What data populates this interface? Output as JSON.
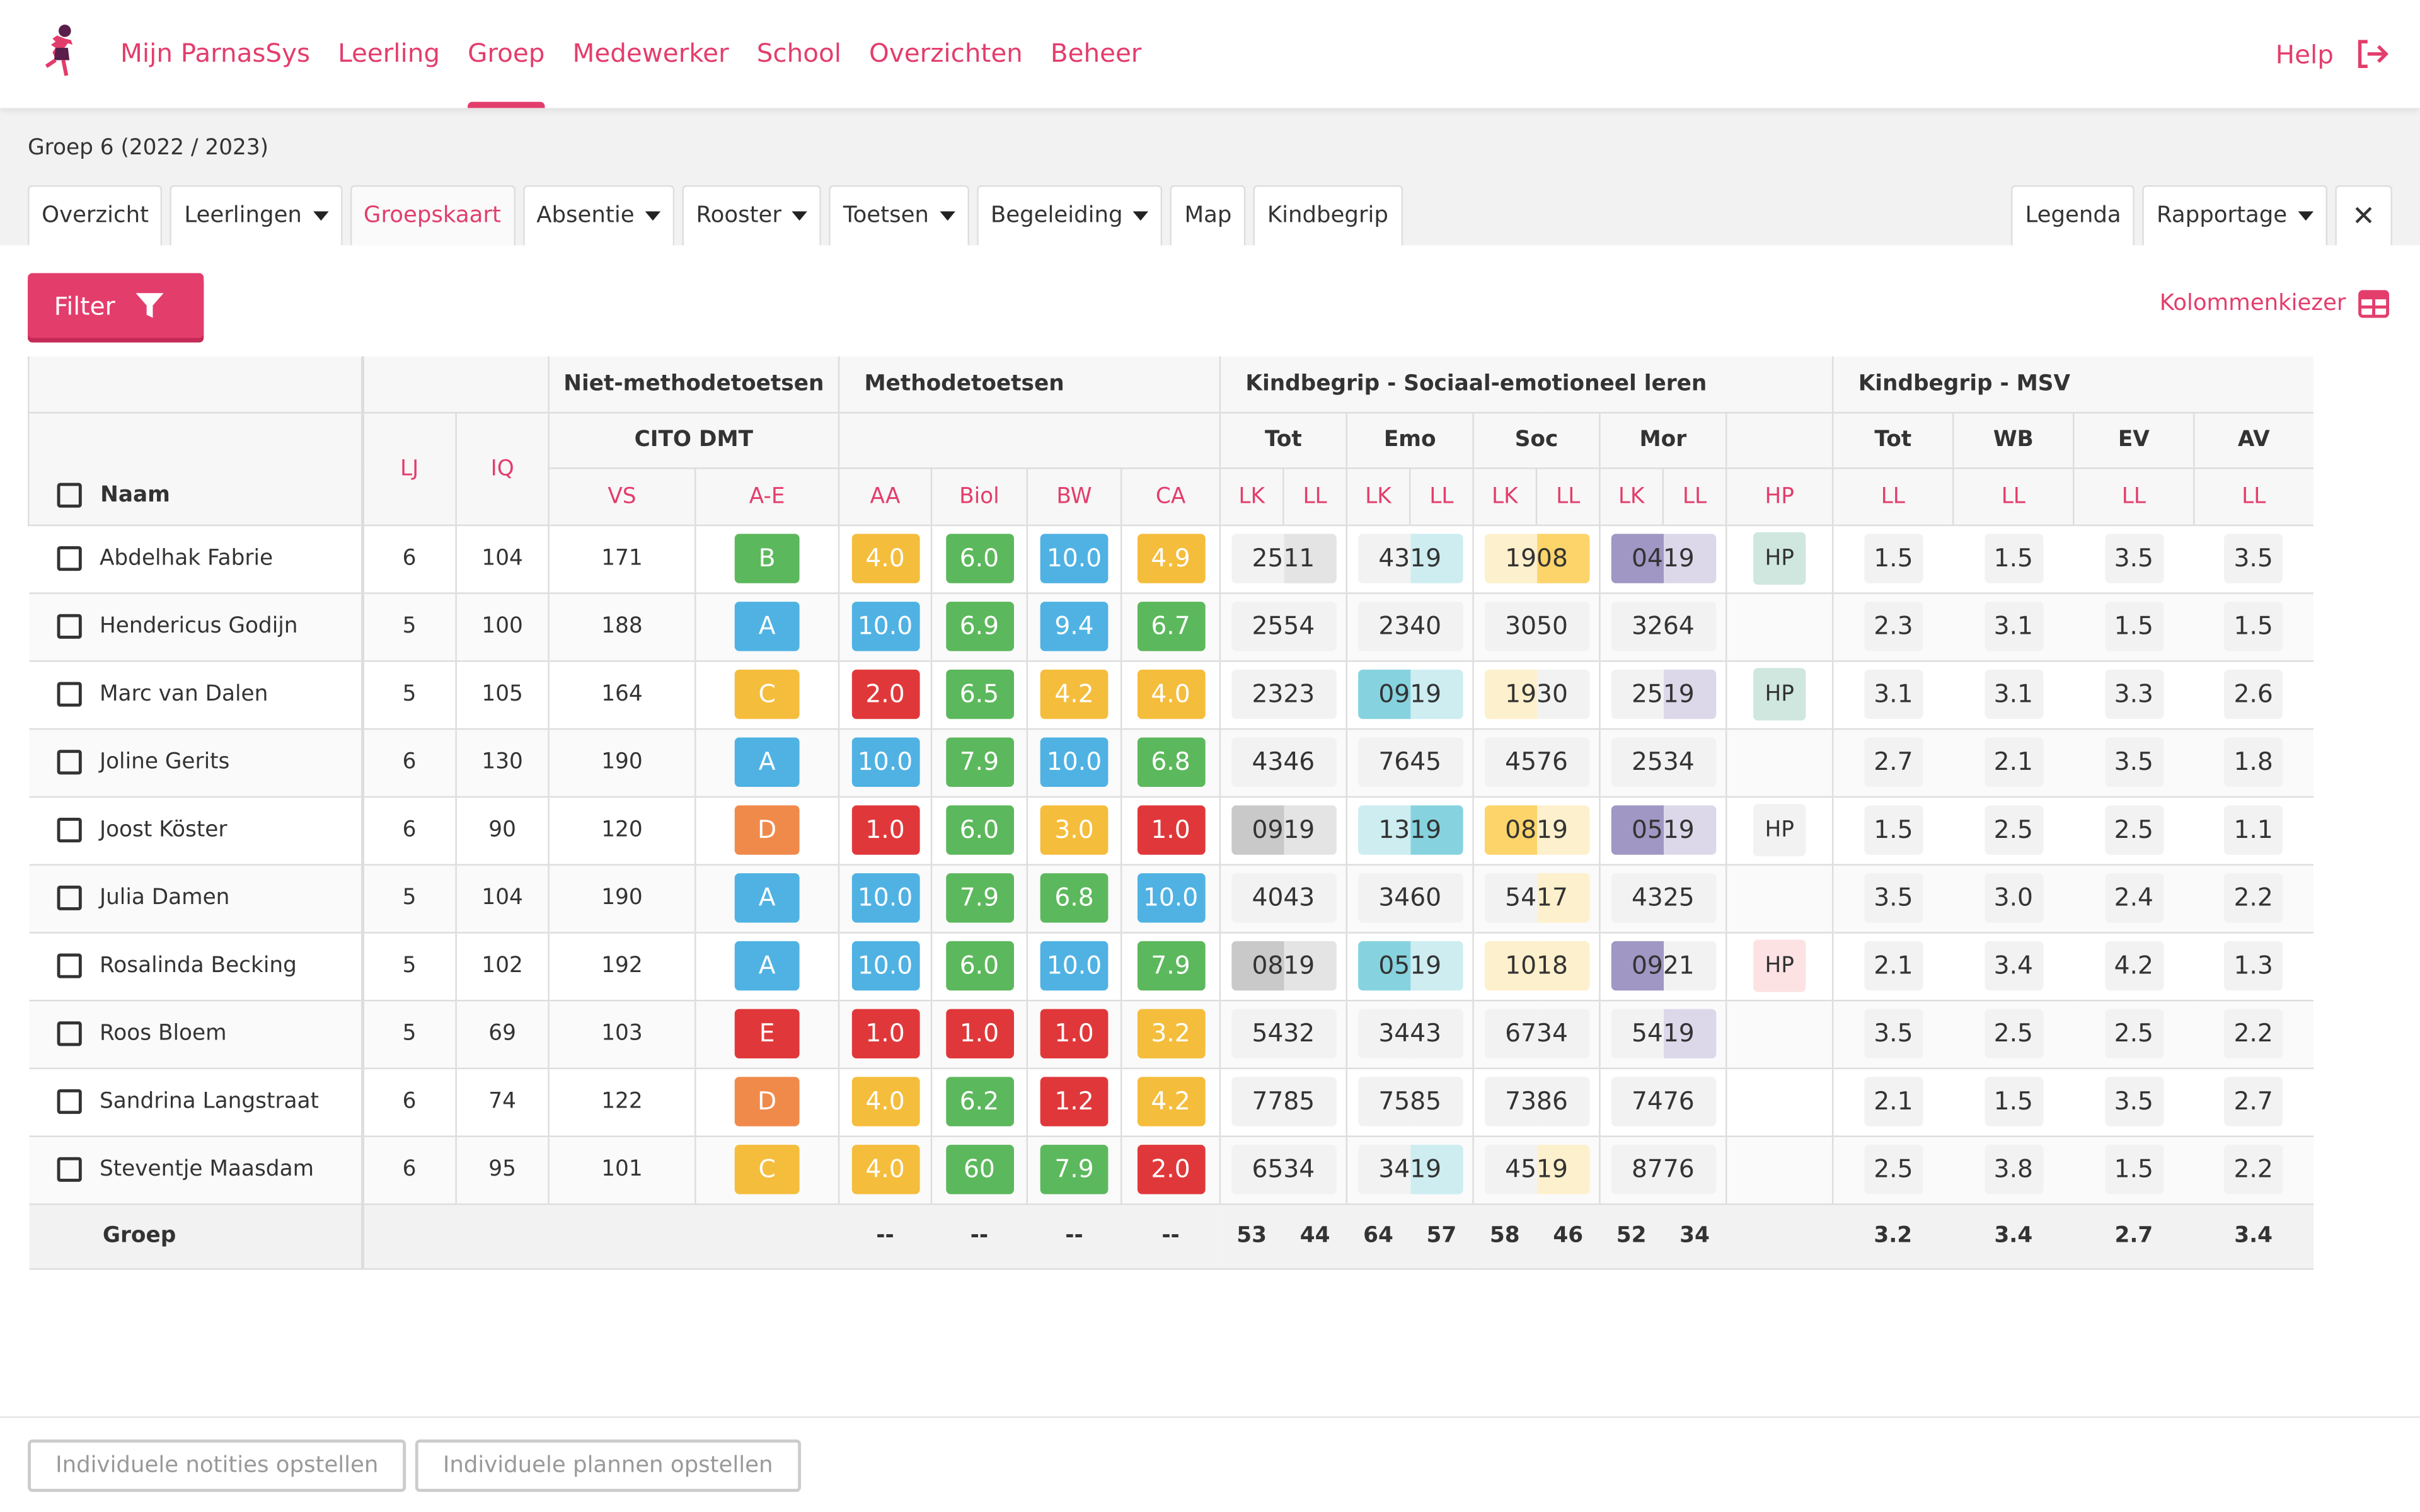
{
  "nav": {
    "items": [
      "Mijn ParnasSys",
      "Leerling",
      "Groep",
      "Medewerker",
      "School",
      "Overzichten",
      "Beheer"
    ],
    "active": "Groep",
    "help": "Help",
    "logout_icon": "logout-icon",
    "brand_color": "#e33d6c"
  },
  "page": {
    "title": "Groep 6 (2022 / 2023)"
  },
  "tabs": [
    {
      "label": "Overzicht",
      "dropdown": false
    },
    {
      "label": "Leerlingen",
      "dropdown": true
    },
    {
      "label": "Groepskaart",
      "dropdown": false,
      "active": true
    },
    {
      "label": "Absentie",
      "dropdown": true
    },
    {
      "label": "Rooster",
      "dropdown": true
    },
    {
      "label": "Toetsen",
      "dropdown": true
    },
    {
      "label": "Begeleiding",
      "dropdown": true
    },
    {
      "label": "Map",
      "dropdown": false
    },
    {
      "label": "Kindbegrip",
      "dropdown": false
    }
  ],
  "tabs_right": {
    "legenda": "Legenda",
    "rapportage": "Rapportage",
    "close": "✕"
  },
  "toolbar": {
    "filter": "Filter",
    "kolommenkiezer": "Kolommenkiezer"
  },
  "headers": {
    "naam": "Naam",
    "lj": "LJ",
    "iq": "IQ",
    "niet_methode": "Niet-methodetoetsen",
    "cito": "CITO  DMT",
    "vs": "VS",
    "ae": "A-E",
    "methode": "Methodetoetsen",
    "aa": "AA",
    "biol": "Biol",
    "bw": "BW",
    "ca": "CA",
    "kb_sel": "Kindbegrip - Sociaal-emotioneel leren",
    "kb_groups": [
      "Tot",
      "Emo",
      "Soc",
      "Mor"
    ],
    "lk": "LK",
    "ll": "LL",
    "hp": "HP",
    "kb_msv": "Kindbegrip - MSV",
    "msv_groups": [
      "Tot",
      "WB",
      "EV",
      "AV"
    ]
  },
  "colors": {
    "Y": "#f5bd3c",
    "G": "#5cb85c",
    "B": "#4fb2e3",
    "R": "#e0383a",
    "O": "#f08a4b",
    "d": "#f2f2f2",
    "g1": "#e4e4e4",
    "g2": "#c9c9c9",
    "cl": "#cdedf1",
    "c": "#86d3df",
    "yl": "#fdf0cc",
    "y": "#fdd46a",
    "p": "#a097c4",
    "pl": "#dcd8ea",
    "mint": "#cfe7df",
    "pink": "#fde2e4"
  },
  "rows": [
    {
      "naam": "Abdelhak Fabrie",
      "lj": "6",
      "iq": "104",
      "vs": "171",
      "ae": [
        "B",
        "G"
      ],
      "met": [
        [
          "4.0",
          "Y"
        ],
        [
          "6.0",
          "G"
        ],
        [
          "10.0",
          "B"
        ],
        [
          "4.9",
          "Y"
        ]
      ],
      "kb": [
        [
          "25",
          "d"
        ],
        [
          "11",
          "g1"
        ],
        [
          "43",
          "d"
        ],
        [
          "19",
          "cl"
        ],
        [
          "19",
          "yl"
        ],
        [
          "08",
          "y"
        ],
        [
          "04",
          "p"
        ],
        [
          "19",
          "pl"
        ]
      ],
      "hp": [
        "HP",
        "mint"
      ],
      "msv": [
        "1.5",
        "1.5",
        "3.5",
        "3.5"
      ]
    },
    {
      "naam": "Hendericus Godijn",
      "lj": "5",
      "iq": "100",
      "vs": "188",
      "ae": [
        "A",
        "B"
      ],
      "met": [
        [
          "10.0",
          "B"
        ],
        [
          "6.9",
          "G"
        ],
        [
          "9.4",
          "B"
        ],
        [
          "6.7",
          "G"
        ]
      ],
      "kb": [
        [
          "25",
          "d"
        ],
        [
          "54",
          "d"
        ],
        [
          "23",
          "d"
        ],
        [
          "40",
          "d"
        ],
        [
          "30",
          "d"
        ],
        [
          "50",
          "d"
        ],
        [
          "32",
          "d"
        ],
        [
          "64",
          "d"
        ]
      ],
      "hp": null,
      "msv": [
        "2.3",
        "3.1",
        "1.5",
        "1.5"
      ]
    },
    {
      "naam": "Marc van Dalen",
      "lj": "5",
      "iq": "105",
      "vs": "164",
      "ae": [
        "C",
        "Y"
      ],
      "met": [
        [
          "2.0",
          "R"
        ],
        [
          "6.5",
          "G"
        ],
        [
          "4.2",
          "Y"
        ],
        [
          "4.0",
          "Y"
        ]
      ],
      "kb": [
        [
          "23",
          "d"
        ],
        [
          "23",
          "d"
        ],
        [
          "09",
          "c"
        ],
        [
          "19",
          "cl"
        ],
        [
          "19",
          "yl"
        ],
        [
          "30",
          "d"
        ],
        [
          "25",
          "d"
        ],
        [
          "19",
          "pl"
        ]
      ],
      "hp": [
        "HP",
        "mint"
      ],
      "msv": [
        "3.1",
        "3.1",
        "3.3",
        "2.6"
      ]
    },
    {
      "naam": "Joline Gerits",
      "lj": "6",
      "iq": "130",
      "vs": "190",
      "ae": [
        "A",
        "B"
      ],
      "met": [
        [
          "10.0",
          "B"
        ],
        [
          "7.9",
          "G"
        ],
        [
          "10.0",
          "B"
        ],
        [
          "6.8",
          "G"
        ]
      ],
      "kb": [
        [
          "43",
          "d"
        ],
        [
          "46",
          "d"
        ],
        [
          "76",
          "d"
        ],
        [
          "45",
          "d"
        ],
        [
          "45",
          "d"
        ],
        [
          "76",
          "d"
        ],
        [
          "25",
          "d"
        ],
        [
          "34",
          "d"
        ]
      ],
      "hp": null,
      "msv": [
        "2.7",
        "2.1",
        "3.5",
        "1.8"
      ]
    },
    {
      "naam": "Joost Köster",
      "lj": "6",
      "iq": "90",
      "vs": "120",
      "ae": [
        "D",
        "O"
      ],
      "met": [
        [
          "1.0",
          "R"
        ],
        [
          "6.0",
          "G"
        ],
        [
          "3.0",
          "Y"
        ],
        [
          "1.0",
          "R"
        ]
      ],
      "kb": [
        [
          "09",
          "g2"
        ],
        [
          "19",
          "g1"
        ],
        [
          "13",
          "cl"
        ],
        [
          "19",
          "c"
        ],
        [
          "08",
          "y"
        ],
        [
          "19",
          "yl"
        ],
        [
          "05",
          "p"
        ],
        [
          "19",
          "pl"
        ]
      ],
      "hp": [
        "HP",
        "d"
      ],
      "msv": [
        "1.5",
        "2.5",
        "2.5",
        "1.1"
      ]
    },
    {
      "naam": "Julia Damen",
      "lj": "5",
      "iq": "104",
      "vs": "190",
      "ae": [
        "A",
        "B"
      ],
      "met": [
        [
          "10.0",
          "B"
        ],
        [
          "7.9",
          "G"
        ],
        [
          "6.8",
          "G"
        ],
        [
          "10.0",
          "B"
        ]
      ],
      "kb": [
        [
          "40",
          "d"
        ],
        [
          "43",
          "d"
        ],
        [
          "34",
          "d"
        ],
        [
          "60",
          "d"
        ],
        [
          "54",
          "d"
        ],
        [
          "17",
          "yl"
        ],
        [
          "43",
          "d"
        ],
        [
          "25",
          "d"
        ]
      ],
      "hp": null,
      "msv": [
        "3.5",
        "3.0",
        "2.4",
        "2.2"
      ]
    },
    {
      "naam": "Rosalinda Becking",
      "lj": "5",
      "iq": "102",
      "vs": "192",
      "ae": [
        "A",
        "B"
      ],
      "met": [
        [
          "10.0",
          "B"
        ],
        [
          "6.0",
          "G"
        ],
        [
          "10.0",
          "B"
        ],
        [
          "7.9",
          "G"
        ]
      ],
      "kb": [
        [
          "08",
          "g2"
        ],
        [
          "19",
          "g1"
        ],
        [
          "05",
          "c"
        ],
        [
          "19",
          "cl"
        ],
        [
          "10",
          "yl"
        ],
        [
          "18",
          "yl"
        ],
        [
          "09",
          "p"
        ],
        [
          "21",
          "d"
        ]
      ],
      "hp": [
        "HP",
        "pink"
      ],
      "msv": [
        "2.1",
        "3.4",
        "4.2",
        "1.3"
      ]
    },
    {
      "naam": "Roos Bloem",
      "lj": "5",
      "iq": "69",
      "vs": "103",
      "ae": [
        "E",
        "R"
      ],
      "met": [
        [
          "1.0",
          "R"
        ],
        [
          "1.0",
          "R"
        ],
        [
          "1.0",
          "R"
        ],
        [
          "3.2",
          "Y"
        ]
      ],
      "kb": [
        [
          "54",
          "d"
        ],
        [
          "32",
          "d"
        ],
        [
          "34",
          "d"
        ],
        [
          "43",
          "d"
        ],
        [
          "67",
          "d"
        ],
        [
          "34",
          "d"
        ],
        [
          "54",
          "d"
        ],
        [
          "19",
          "pl"
        ]
      ],
      "hp": null,
      "msv": [
        "3.5",
        "2.5",
        "2.5",
        "2.2"
      ]
    },
    {
      "naam": "Sandrina Langstraat",
      "lj": "6",
      "iq": "74",
      "vs": "122",
      "ae": [
        "D",
        "O"
      ],
      "met": [
        [
          "4.0",
          "Y"
        ],
        [
          "6.2",
          "G"
        ],
        [
          "1.2",
          "R"
        ],
        [
          "4.2",
          "Y"
        ]
      ],
      "kb": [
        [
          "77",
          "d"
        ],
        [
          "85",
          "d"
        ],
        [
          "75",
          "d"
        ],
        [
          "85",
          "d"
        ],
        [
          "73",
          "d"
        ],
        [
          "86",
          "d"
        ],
        [
          "74",
          "d"
        ],
        [
          "76",
          "d"
        ]
      ],
      "hp": null,
      "msv": [
        "2.1",
        "1.5",
        "3.5",
        "2.7"
      ]
    },
    {
      "naam": "Steventje Maasdam",
      "lj": "6",
      "iq": "95",
      "vs": "101",
      "ae": [
        "C",
        "Y"
      ],
      "met": [
        [
          "4.0",
          "Y"
        ],
        [
          "60",
          "G"
        ],
        [
          "7.9",
          "G"
        ],
        [
          "2.0",
          "R"
        ]
      ],
      "kb": [
        [
          "65",
          "d"
        ],
        [
          "34",
          "d"
        ],
        [
          "34",
          "d"
        ],
        [
          "19",
          "cl"
        ],
        [
          "45",
          "d"
        ],
        [
          "19",
          "yl"
        ],
        [
          "87",
          "d"
        ],
        [
          "76",
          "d"
        ]
      ],
      "hp": null,
      "msv": [
        "2.5",
        "3.8",
        "1.5",
        "2.2"
      ]
    }
  ],
  "group": {
    "label": "Groep",
    "met": [
      "--",
      "--",
      "--",
      "--"
    ],
    "kb": [
      "53",
      "44",
      "64",
      "57",
      "58",
      "46",
      "52",
      "34"
    ],
    "msv": [
      "3.2",
      "3.4",
      "2.7",
      "3.4"
    ]
  },
  "footer": {
    "notities": "Individuele notities opstellen",
    "plannen": "Individuele plannen opstellen"
  }
}
